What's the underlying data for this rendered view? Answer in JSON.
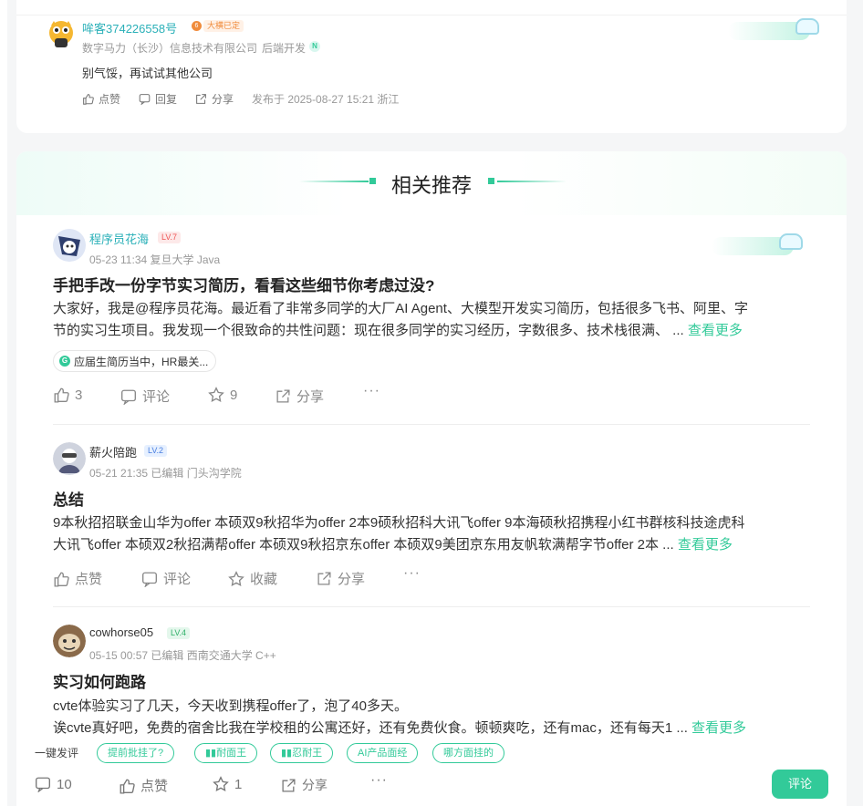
{
  "top_comment": {
    "username": "哞客374226558号",
    "badge": "大横已定",
    "company": "数字马力（长沙）信息技术有限公司",
    "role": "后端开发",
    "role_badge": "N",
    "text": "别气馁，再试试其他公司",
    "actions": {
      "like": "点赞",
      "reply": "回复",
      "share": "分享"
    },
    "published": "发布于 2025-08-27 15:21 浙江"
  },
  "recommend": {
    "section_title": "相关推荐",
    "posts": [
      {
        "author": "程序员花海",
        "level": "LV.7",
        "meta": "05-23 11:34  复旦大学 Java",
        "title": "手把手改一份字节实习简历，看看这些细节你考虑过没?",
        "body_line1": "大家好，我是@程序员花海。最近看了非常多同学的大厂AI Agent、大模型开发实习简历，包括很多飞书、阿里、字",
        "body_line2": "节的实习生项目。我发现一个很致命的共性问题：现在很多同学的实习经历，字数很多、技术栈很满、 ...",
        "see_more": "查看更多",
        "topic": "应届生简历当中，HR最关...",
        "topic_icon": "G",
        "likes": "3",
        "comment": "评论",
        "stars": "9",
        "share": "分享",
        "more": "···"
      },
      {
        "author": "薪火陪跑",
        "level": "LV.2",
        "meta": "05-21 21:35  已编辑  门头沟学院",
        "title": "总结",
        "body_line1": "9本秋招招联金山华为offer 本硕双9秋招华为offer 2本9硕秋招科大讯飞offer 9本海硕秋招携程小红书群核科技途虎科",
        "body_line2": "大讯飞offer 本硕双2秋招满帮offer 本硕双9秋招京东offer 本硕双9美团京东用友帆软满帮字节offer 2本 ...",
        "see_more": "查看更多",
        "likes": "点赞",
        "comment": "评论",
        "stars": "收藏",
        "share": "分享",
        "more": "···"
      },
      {
        "author": "cowhorse05",
        "level": "LV.4",
        "meta": "05-15 00:57  已编辑  西南交通大学 C++",
        "title": "实习如何跑路",
        "body_line1": "cvte体验实习了几天，今天收到携程offer了，泡了40多天。",
        "body_line2": "诶cvte真好吧，免费的宿舍比我在学校租的公寓还好，还有免费伙食。顿顿爽吃，还有mac，还有每天1 ...",
        "see_more": "查看更多"
      }
    ]
  },
  "bottom": {
    "quick_label": "一键发评",
    "chips": [
      "提前批挂了?",
      "耐面王",
      "忍耐王",
      "AI产品面经",
      "哪方面挂的"
    ],
    "comments": "10",
    "like": "点赞",
    "stars": "1",
    "share": "分享",
    "more": "···",
    "comment_button": "评论"
  },
  "colors": {
    "accent": "#32ca99",
    "username_gradient": "#3aaee0",
    "badge_orange": "#f08c3c"
  }
}
